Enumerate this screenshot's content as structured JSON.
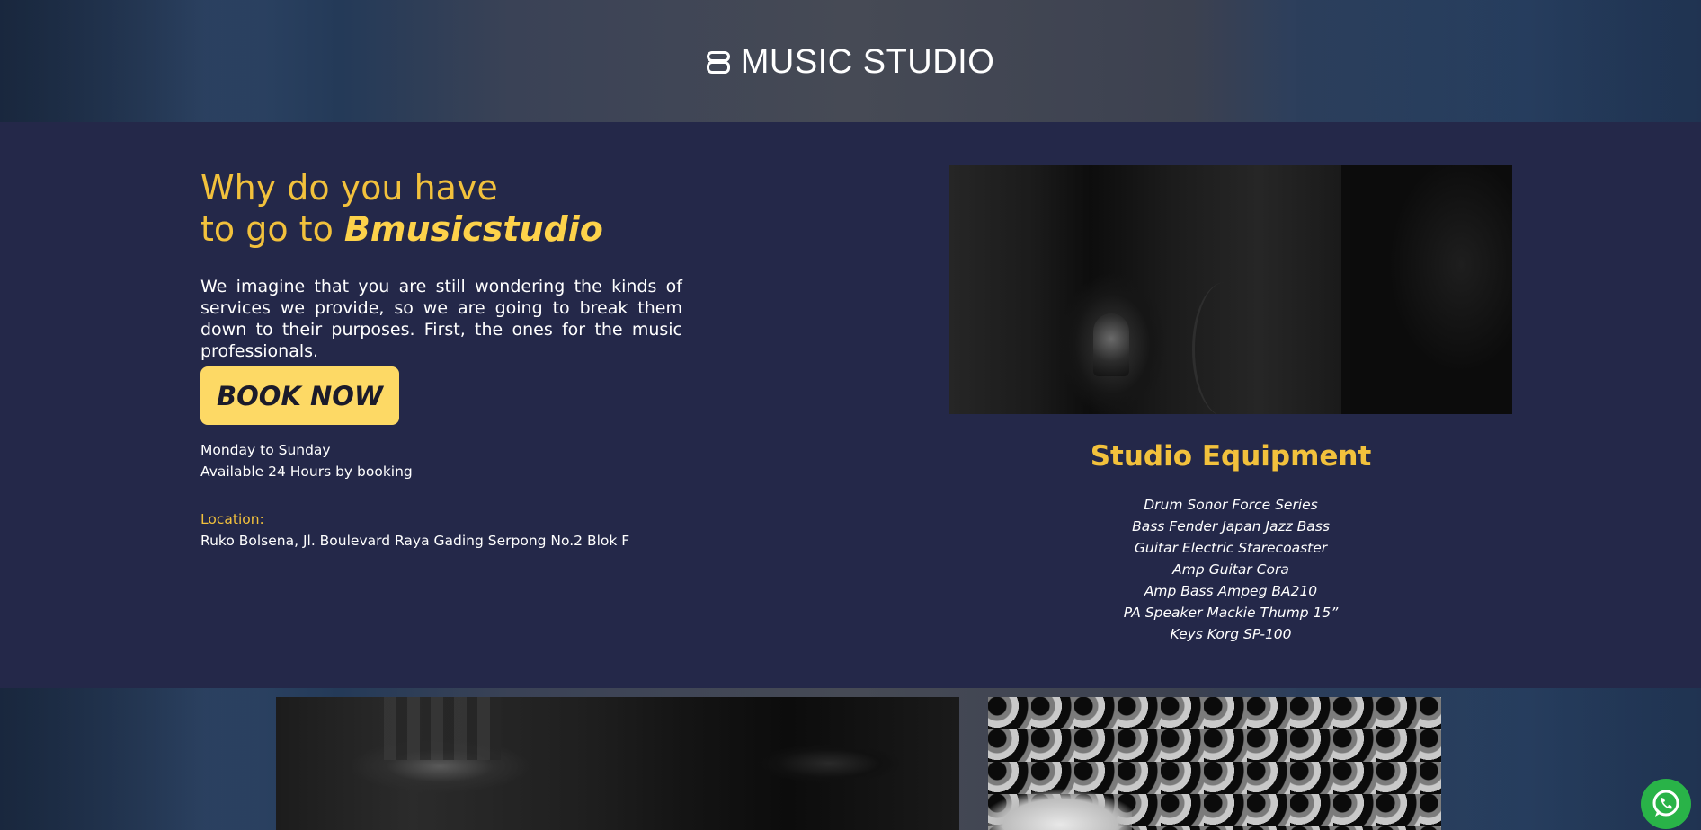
{
  "header": {
    "logo_text": "MUSIC STUDIO"
  },
  "intro": {
    "heading_line1": "Why do you have",
    "heading_line2_prefix": "to go to ",
    "heading_brand": "Bmusicstudio",
    "paragraph": "We imagine that you are still wondering the kinds of services we provide, so we are going to break them down to their purposes. First, the ones for the music professionals.",
    "book_button": "BOOK NOW",
    "days": "Monday to Sunday",
    "availability": "Available 24 Hours by booking",
    "location_label": "Location:",
    "location_value": "Ruko Bolsena, Jl. Boulevard Raya Gading Serpong No.2 Blok F"
  },
  "equipment": {
    "title": "Studio Equipment",
    "items": [
      "Drum Sonor Force Series",
      "Bass Fender Japan Jazz Bass",
      "Guitar Electric Starecoaster",
      "Amp Guitar Cora",
      "Amp Bass Ampeg BA210",
      "PA Speaker Mackie Thump 15”",
      "Keys Korg SP-100"
    ]
  },
  "colors": {
    "accent": "#f2c13c",
    "button_bg": "#fdd965",
    "panel_bg": "#242849",
    "whatsapp": "#29b348"
  },
  "icons": {
    "floating_button": "whatsapp-icon",
    "logo": "b-logo-icon"
  }
}
